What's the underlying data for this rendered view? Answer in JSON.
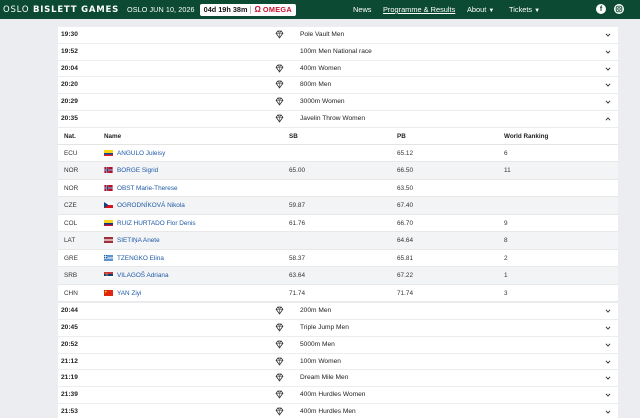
{
  "header": {
    "brand_a": "OSLO",
    "brand_b": "BISLETT GAMES",
    "dateline": "OSLO JUN 10, 2026",
    "countdown": "04d 19h 38m",
    "sponsor": "OMEGA",
    "nav": [
      "News",
      "Programme & Results",
      "About",
      "Tickets"
    ],
    "social": [
      "facebook-icon",
      "instagram-icon"
    ]
  },
  "events_before": [
    {
      "time": "19:30",
      "name": "Pole Vault Men",
      "medal": true
    },
    {
      "time": "19:52",
      "name": "100m Men National race",
      "medal": false
    },
    {
      "time": "20:04",
      "name": "400m Women",
      "medal": true
    },
    {
      "time": "20:20",
      "name": "800m Men",
      "medal": true
    },
    {
      "time": "20:29",
      "name": "3000m Women",
      "medal": true
    }
  ],
  "expanded_event": {
    "time": "20:35",
    "name": "Javelin Throw Women",
    "medal": true
  },
  "table": {
    "headers": {
      "nat": "Nat.",
      "name": "Name",
      "sb": "SB",
      "pb": "PB",
      "wr": "World Ranking"
    },
    "rows": [
      {
        "nat": "ECU",
        "name": "ANGULO Juleisy",
        "sb": "",
        "pb": "65.12",
        "wr": "6"
      },
      {
        "nat": "NOR",
        "name": "BORGE Sigrid",
        "sb": "65.00",
        "pb": "66.50",
        "wr": "11"
      },
      {
        "nat": "NOR",
        "name": "OBST Marie-Therese",
        "sb": "",
        "pb": "63.50",
        "wr": ""
      },
      {
        "nat": "CZE",
        "name": "OGRODNÍKOVÁ Nikola",
        "sb": "59.87",
        "pb": "67.40",
        "wr": ""
      },
      {
        "nat": "COL",
        "name": "RUIZ HURTADO Flor Denis",
        "sb": "61.76",
        "pb": "66.70",
        "wr": "9"
      },
      {
        "nat": "LAT",
        "name": "SIETIŅA Anete",
        "sb": "",
        "pb": "64.64",
        "wr": "8"
      },
      {
        "nat": "GRE",
        "name": "TZENGKO Elina",
        "sb": "58.37",
        "pb": "65.81",
        "wr": "2"
      },
      {
        "nat": "SRB",
        "name": "VILAGOŠ Adriana",
        "sb": "63.64",
        "pb": "67.22",
        "wr": "1"
      },
      {
        "nat": "CHN",
        "name": "YAN Ziyi",
        "sb": "71.74",
        "pb": "71.74",
        "wr": "3"
      }
    ]
  },
  "events_after": [
    {
      "time": "20:44",
      "name": "200m Men",
      "medal": true
    },
    {
      "time": "20:45",
      "name": "Triple Jump Men",
      "medal": true
    },
    {
      "time": "20:52",
      "name": "5000m Men",
      "medal": true
    },
    {
      "time": "21:12",
      "name": "100m Women",
      "medal": true
    },
    {
      "time": "21:19",
      "name": "Dream Mile Men",
      "medal": true
    },
    {
      "time": "21:39",
      "name": "400m Hurdles Women",
      "medal": true
    },
    {
      "time": "21:53",
      "name": "400m Hurdles Men",
      "medal": true
    }
  ],
  "colors": {
    "header_bg": "#0c4a34",
    "link": "#1f5aa6",
    "omega": "#c8102e",
    "page_bg": "#ecedf0"
  }
}
